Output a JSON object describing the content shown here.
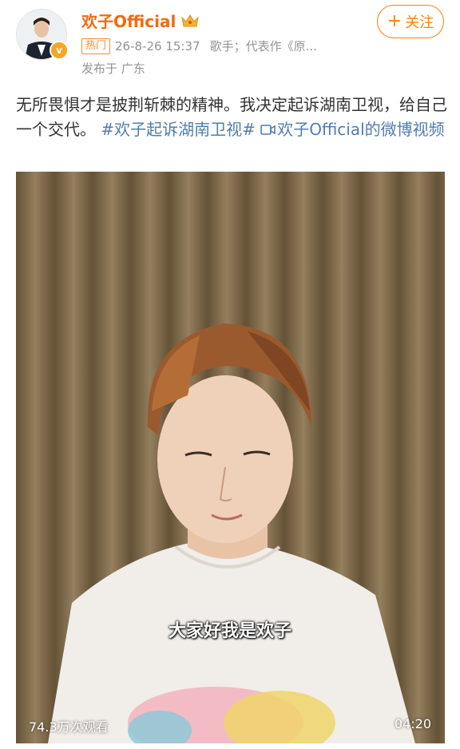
{
  "header": {
    "username": "欢子Official",
    "follow_label": "关注",
    "hot_badge": "热门",
    "time": "26-8-26 15:37",
    "description": "歌手；代表作《原...",
    "location": "发布于 广东"
  },
  "post": {
    "text": "无所畏惧才是披荆斩棘的精神。我决定起诉湖南卫视，给自己一个交代。",
    "hashtag": "#欢子起诉湖南卫视#",
    "video_link": "欢子Official的微博视频"
  },
  "video": {
    "subtitle": "大家好我是欢子",
    "views": "74.3万次观看",
    "duration": "04:20"
  },
  "colors": {
    "username": "#f06b10",
    "accent": "#ff8200",
    "link": "#507daf",
    "meta": "#939393"
  },
  "icons": [
    "avatar",
    "verified-badge-icon",
    "crown-icon",
    "plus-icon",
    "video-camera-icon"
  ]
}
